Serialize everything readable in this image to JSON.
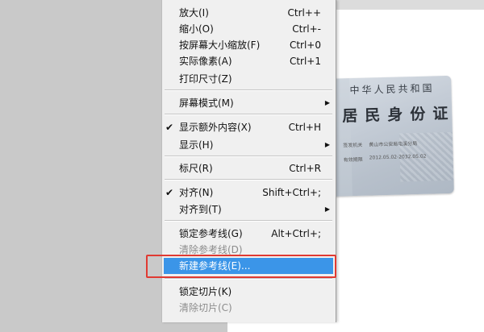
{
  "id_card": {
    "line1": "中华人民共和国",
    "line2": "居民身份证",
    "authority_label": "签发机关",
    "authority": "黄山市公安局屯溪分局",
    "valid_label": "有效期限",
    "valid": "2012.05.02-2032.05.02"
  },
  "menu": {
    "items": [
      {
        "label": "放大(I)",
        "shortcut": "Ctrl++"
      },
      {
        "label": "缩小(O)",
        "shortcut": "Ctrl+-"
      },
      {
        "label": "按屏幕大小缩放(F)",
        "shortcut": "Ctrl+0"
      },
      {
        "label": "实际像素(A)",
        "shortcut": "Ctrl+1"
      },
      {
        "label": "打印尺寸(Z)",
        "shortcut": ""
      },
      {
        "label": "屏幕模式(M)",
        "submenu": true
      },
      {
        "label": "显示额外内容(X)",
        "shortcut": "Ctrl+H",
        "checked": true
      },
      {
        "label": "显示(H)",
        "submenu": true
      },
      {
        "label": "标尺(R)",
        "shortcut": "Ctrl+R"
      },
      {
        "label": "对齐(N)",
        "shortcut": "Shift+Ctrl+;",
        "checked": true
      },
      {
        "label": "对齐到(T)",
        "submenu": true
      },
      {
        "label": "锁定参考线(G)",
        "shortcut": "Alt+Ctrl+;"
      },
      {
        "label": "清除参考线(D)",
        "disabled": true
      },
      {
        "label": "新建参考线(E)...",
        "highlighted": true
      },
      {
        "label": "锁定切片(K)"
      },
      {
        "label": "清除切片(C)",
        "disabled": true
      }
    ],
    "check_glyph": "✔",
    "submenu_glyph": "▶"
  },
  "colors": {
    "menu_bg": "#f0f0f0",
    "highlight": "#3b95e8",
    "annotation_box": "#e03a32",
    "workspace": "#c9c9c9"
  }
}
